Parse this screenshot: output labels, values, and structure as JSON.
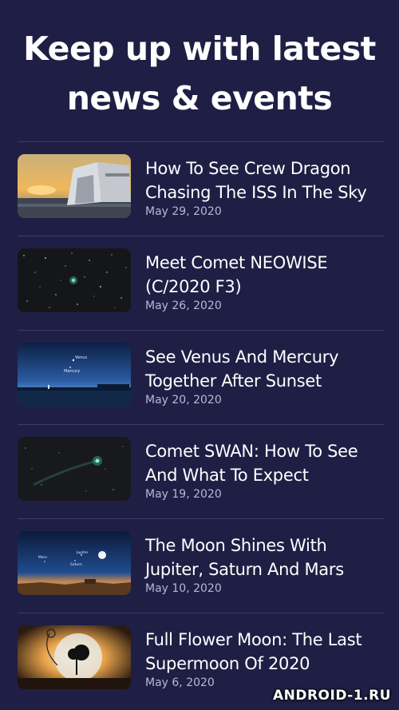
{
  "header": {
    "title_line1": "Keep up with latest",
    "title_line2": "news & events"
  },
  "news": [
    {
      "title": "How To See Crew Dragon Chasing The ISS In The Sky",
      "date": "May 29, 2020"
    },
    {
      "title": "Meet Comet NEOWISE (C/2020 F3)",
      "date": "May 26, 2020"
    },
    {
      "title": "See Venus And Mercury Together After Sunset",
      "date": "May 20, 2020",
      "thumb_labels": [
        "Venus",
        "Mercury"
      ]
    },
    {
      "title": "Comet SWAN: How To See And What To Expect",
      "date": "May 19, 2020"
    },
    {
      "title": "The Moon Shines With Jupiter, Saturn And Mars",
      "date": "May 10, 2020",
      "thumb_labels": [
        "Jupiter",
        "Saturn",
        "Mars"
      ]
    },
    {
      "title": "Full Flower Moon: The Last Supermoon Of 2020",
      "date": "May 6, 2020"
    }
  ],
  "watermark": "ANDROID-1.RU",
  "colors": {
    "background": "#1f1f45",
    "divider": "#3c3c66",
    "date_text": "#b7b7d6"
  }
}
